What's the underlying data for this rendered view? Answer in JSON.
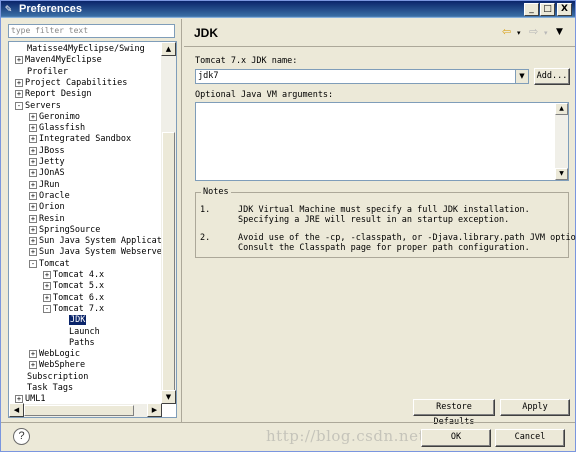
{
  "window": {
    "title": "Preferences",
    "controls": [
      "_",
      "□",
      "X"
    ]
  },
  "filter": {
    "placeholder": "type filter text"
  },
  "tree": {
    "items": [
      {
        "label": "Matisse4MyEclipse/Swing",
        "expander": "",
        "level": 1
      },
      {
        "label": "Maven4MyEclipse",
        "expander": "+",
        "level": 1
      },
      {
        "label": "Profiler",
        "expander": "",
        "level": 1
      },
      {
        "label": "Project Capabilities",
        "expander": "+",
        "level": 1
      },
      {
        "label": "Report Design",
        "expander": "+",
        "level": 1
      },
      {
        "label": "Servers",
        "expander": "-",
        "level": 1
      },
      {
        "label": "Geronimo",
        "expander": "+",
        "level": 2
      },
      {
        "label": "Glassfish",
        "expander": "+",
        "level": 2
      },
      {
        "label": "Integrated Sandbox",
        "expander": "+",
        "level": 2
      },
      {
        "label": "JBoss",
        "expander": "+",
        "level": 2
      },
      {
        "label": "Jetty",
        "expander": "+",
        "level": 2
      },
      {
        "label": "JOnAS",
        "expander": "+",
        "level": 2
      },
      {
        "label": "JRun",
        "expander": "+",
        "level": 2
      },
      {
        "label": "Oracle",
        "expander": "+",
        "level": 2
      },
      {
        "label": "Orion",
        "expander": "+",
        "level": 2
      },
      {
        "label": "Resin",
        "expander": "+",
        "level": 2
      },
      {
        "label": "SpringSource",
        "expander": "+",
        "level": 2
      },
      {
        "label": "Sun Java System Applicat",
        "expander": "+",
        "level": 2
      },
      {
        "label": "Sun Java System Webserve",
        "expander": "+",
        "level": 2
      },
      {
        "label": "Tomcat",
        "expander": "-",
        "level": 2
      },
      {
        "label": "Tomcat  4.x",
        "expander": "+",
        "level": 3
      },
      {
        "label": "Tomcat  5.x",
        "expander": "+",
        "level": 3
      },
      {
        "label": "Tomcat  6.x",
        "expander": "+",
        "level": 3
      },
      {
        "label": "Tomcat  7.x",
        "expander": "-",
        "level": 3
      },
      {
        "label": "JDK",
        "expander": "",
        "level": 4,
        "selected": true
      },
      {
        "label": "Launch",
        "expander": "",
        "level": 4
      },
      {
        "label": "Paths",
        "expander": "",
        "level": 4
      },
      {
        "label": "WebLogic",
        "expander": "+",
        "level": 2
      },
      {
        "label": "WebSphere",
        "expander": "+",
        "level": 2
      },
      {
        "label": "Subscription",
        "expander": "",
        "level": 1
      },
      {
        "label": "Task Tags",
        "expander": "",
        "level": 1
      },
      {
        "label": "UML1",
        "expander": "+",
        "level": 1
      }
    ]
  },
  "page": {
    "title": "JDK",
    "jdk_name_label": "Tomcat  7.x JDK name:",
    "jdk_name_value": "jdk7",
    "add_button": "Add...",
    "vm_args_label": "Optional Java VM arguments:",
    "vm_args_value": "",
    "notes_title": "Notes",
    "notes": [
      {
        "num": "1.",
        "text": "JDK Virtual Machine must specify a full JDK installation.\nSpecifying a JRE will result in an startup exception."
      },
      {
        "num": "2.",
        "text": "Avoid use of the -cp, -classpath, or -Djava.library.path JVM options.\nConsult the Classpath page for proper path configuration."
      }
    ],
    "restore_defaults": "Restore Defaults",
    "apply": "Apply"
  },
  "footer": {
    "ok": "OK",
    "cancel": "Cancel",
    "watermark": "http://blog.csdn.net/"
  },
  "icons": {
    "back": "back-arrow-icon",
    "forward": "forward-arrow-icon",
    "menu": "view-menu-icon",
    "help": "help-icon"
  },
  "colors": {
    "selection": "#0a246a",
    "dialog_bg": "#ece9d8",
    "back_arrow": "#d9a21b"
  }
}
